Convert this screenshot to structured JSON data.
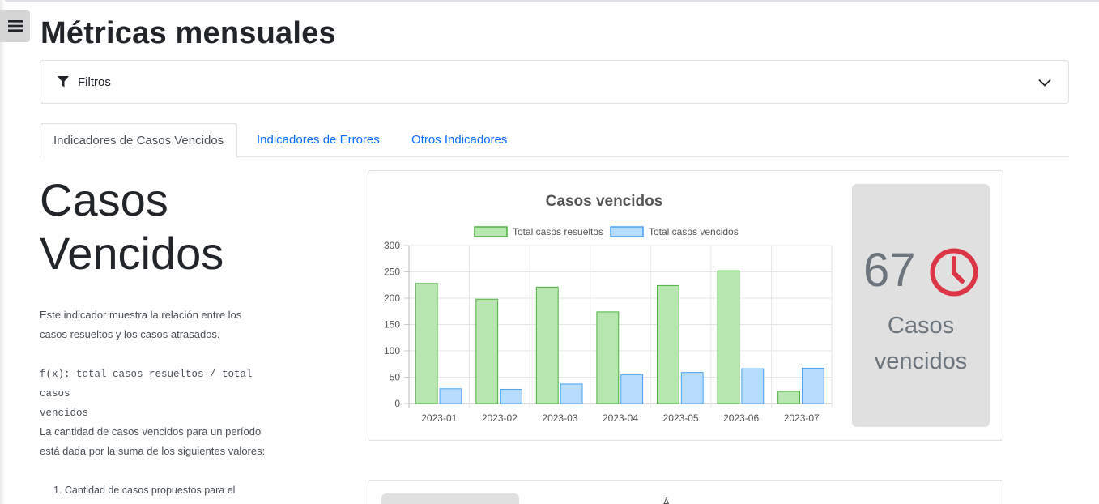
{
  "page": {
    "title": "Métricas mensuales"
  },
  "filters": {
    "label": "Filtros"
  },
  "tabs": [
    {
      "label": "Indicadores de Casos Vencidos",
      "active": true
    },
    {
      "label": "Indicadores de Errores",
      "active": false
    },
    {
      "label": "Otros Indicadores",
      "active": false
    }
  ],
  "section": {
    "title_line1": "Casos",
    "title_line2": "Vencidos",
    "desc1_line1": "Este indicador muestra la relación entre los",
    "desc1_line2": "casos resueltos y los casos atrasados.",
    "formula_line1": "f(x): total casos resueltos / total casos",
    "formula_line2": "vencidos",
    "desc2_line1": "La cantidad de casos vencidos para un período",
    "desc2_line2": "está dada por la suma de los siguientes valores:",
    "list_item1": "1. Cantidad de casos propuestos para el"
  },
  "kpi": {
    "value": "67",
    "label_line1": "Casos",
    "label_line2": "vencidos",
    "icon": "clock-icon",
    "icon_color": "#dc3545"
  },
  "second_card": {
    "partial_text": "Á"
  },
  "chart_data": {
    "type": "bar",
    "title": "Casos vencidos",
    "categories": [
      "2023-01",
      "2023-02",
      "2023-03",
      "2023-04",
      "2023-05",
      "2023-06",
      "2023-07"
    ],
    "series": [
      {
        "name": "Total casos resueltos",
        "values": [
          228,
          198,
          221,
          174,
          224,
          252,
          23
        ],
        "color": "#b8e6b0",
        "border": "#4cb33c"
      },
      {
        "name": "Total casos vencidos",
        "values": [
          28,
          27,
          37,
          55,
          59,
          66,
          67
        ],
        "color": "#b8dcfd",
        "border": "#47a3f3"
      }
    ],
    "ylim": [
      0,
      300
    ],
    "yticks": [
      0,
      50,
      100,
      150,
      200,
      250,
      300
    ],
    "grid": true,
    "legend": "top"
  }
}
